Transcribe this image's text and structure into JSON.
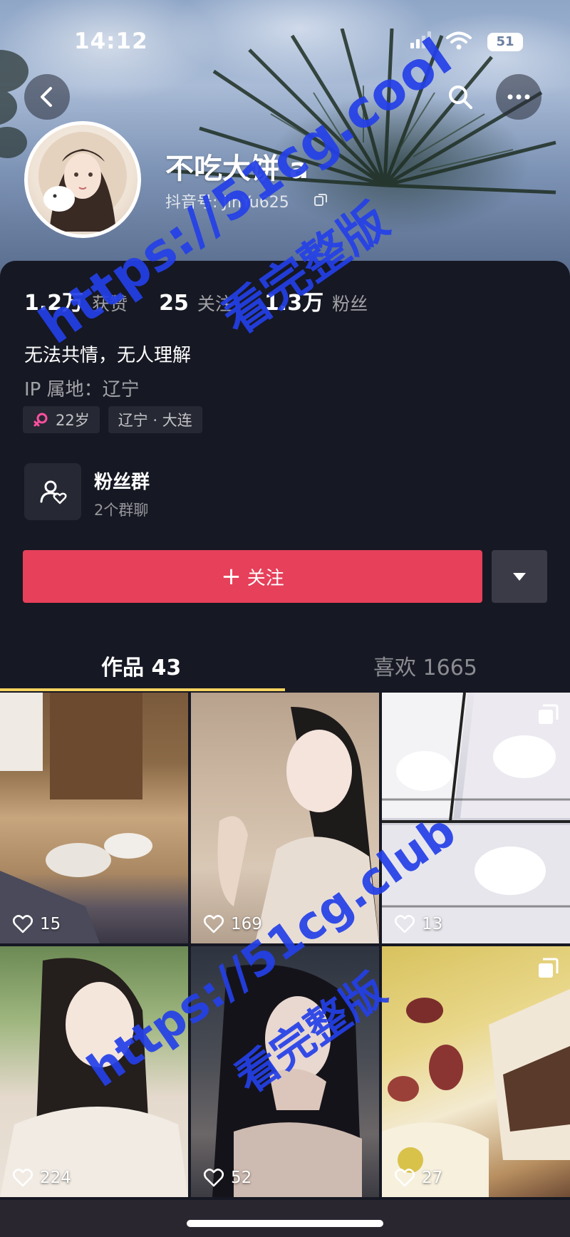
{
  "status_bar": {
    "time": "14:12",
    "battery": "51"
  },
  "profile": {
    "nickname": "不吃大饼 a",
    "douyin_id": "抖音号: JinYu625"
  },
  "stats": [
    {
      "value": "1.2万",
      "label": "获赞"
    },
    {
      "value": "25",
      "label": "关注"
    },
    {
      "value": "1.3万",
      "label": "粉丝"
    }
  ],
  "bio": "无法共情，无人理解",
  "ip_location": "IP 属地：辽宁",
  "tags": {
    "age": "22岁",
    "region": "辽宁 · 大连"
  },
  "fan_group": {
    "title": "粉丝群",
    "subtitle": "2个群聊"
  },
  "actions": {
    "follow_label": "关注",
    "follow_icon": "plus-icon"
  },
  "tabs": [
    {
      "label": "作品 43",
      "active": true
    },
    {
      "label": "喜欢 1665",
      "active": false
    }
  ],
  "videos": [
    {
      "likes": "15",
      "multi": false
    },
    {
      "likes": "169",
      "multi": false
    },
    {
      "likes": "13",
      "multi": true
    },
    {
      "likes": "224",
      "multi": false
    },
    {
      "likes": "52",
      "multi": false
    },
    {
      "likes": "27",
      "multi": true
    }
  ],
  "watermarks": {
    "top_url": "https://51cg.cool",
    "top_text": "看完整版",
    "bottom_url": "https://51cg.club",
    "bottom_text": "看完整版"
  },
  "colors": {
    "background": "#161823",
    "follow_button": "#e6405a",
    "tab_underline": "#f4d25e",
    "female_icon": "#ff4fa0",
    "watermark": "#2440e8"
  }
}
